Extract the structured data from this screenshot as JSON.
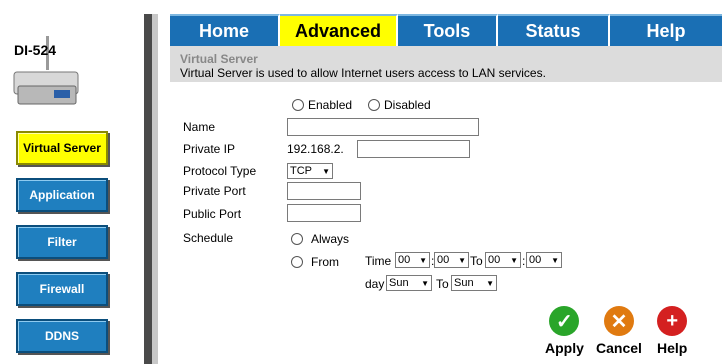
{
  "device": {
    "model": "DI-524"
  },
  "sidebar": {
    "items": [
      {
        "label": "Virtual Server",
        "active": true
      },
      {
        "label": "Application",
        "active": false
      },
      {
        "label": "Filter",
        "active": false
      },
      {
        "label": "Firewall",
        "active": false
      },
      {
        "label": "DDNS",
        "active": false
      }
    ]
  },
  "tabs": [
    {
      "label": "Home"
    },
    {
      "label": "Advanced"
    },
    {
      "label": "Tools"
    },
    {
      "label": "Status"
    },
    {
      "label": "Help"
    }
  ],
  "section": {
    "title": "Virtual Server",
    "description": "Virtual Server is used to allow Internet users access to LAN services."
  },
  "form": {
    "enabled_label": "Enabled",
    "disabled_label": "Disabled",
    "name_label": "Name",
    "name_value": "",
    "private_ip_label": "Private IP",
    "private_ip_prefix": "192.168.2.",
    "private_ip_value": "",
    "protocol_label": "Protocol Type",
    "protocol_value": "TCP",
    "private_port_label": "Private Port",
    "private_port_value": "",
    "public_port_label": "Public Port",
    "public_port_value": "",
    "schedule_label": "Schedule",
    "always_label": "Always",
    "from_label": "From",
    "time_label": "Time",
    "time_start_hour": "00",
    "time_start_min": "00",
    "to_label": "To",
    "time_end_hour": "00",
    "time_end_min": "00",
    "day_label": "day",
    "day_start": "Sun",
    "day_to_label": "To",
    "day_end": "Sun",
    "colon": ":"
  },
  "actions": {
    "apply": "Apply",
    "cancel": "Cancel",
    "help": "Help"
  },
  "colors": {
    "tab_blue": "#1a6fb4",
    "active_yellow": "#ffff00",
    "apply_green": "#2aa52a",
    "cancel_orange": "#e07a10",
    "help_red": "#d42020"
  }
}
